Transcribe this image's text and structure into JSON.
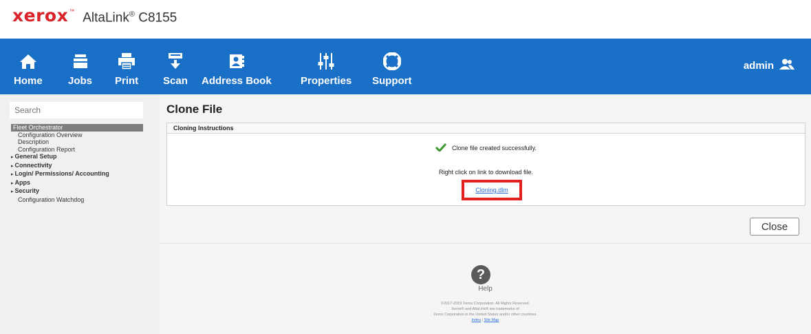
{
  "brand": {
    "logo": "xerox",
    "model": "AltaLink",
    "reg": "®",
    "model_num": " C8155"
  },
  "nav": {
    "items": [
      {
        "label": "Home",
        "icon": "home-icon"
      },
      {
        "label": "Jobs",
        "icon": "jobs-icon"
      },
      {
        "label": "Print",
        "icon": "print-icon"
      },
      {
        "label": "Scan",
        "icon": "scan-icon"
      },
      {
        "label": "Address Book",
        "icon": "address-book-icon"
      },
      {
        "label": "Properties",
        "icon": "properties-icon"
      },
      {
        "label": "Support",
        "icon": "support-icon"
      }
    ],
    "user": "admin"
  },
  "sidebar": {
    "search_placeholder": "Search",
    "items": [
      "Fleet Orchestrator",
      "Configuration Overview",
      "Description",
      "Configuration Report",
      "General Setup",
      "Connectivity",
      "Login/ Permissions/ Accounting",
      "Apps",
      "Security",
      "Configuration Watchdog"
    ]
  },
  "main": {
    "title": "Clone File",
    "panel_header": "Cloning Instructions",
    "success_msg": "Clone file created successfully.",
    "instruction": "Right click on link to download file.",
    "download_link": "Cloning.dlm",
    "close_label": "Close"
  },
  "footer": {
    "help_label": "Help",
    "copyright": [
      "©2017-2019 Xerox Corporation. All Rights Reserved.",
      "Xerox® and AltaLink® are trademarks of",
      "Xerox Corporation in the United States and/or other countries."
    ],
    "link_index": "Index",
    "link_separator": " | ",
    "link_sitemap": "Site Map"
  },
  "colors": {
    "nav_bg": "#1a6fc7",
    "brand_red": "#d8232a",
    "highlight_red": "#e2201e",
    "success_green": "#3a9a2e"
  }
}
